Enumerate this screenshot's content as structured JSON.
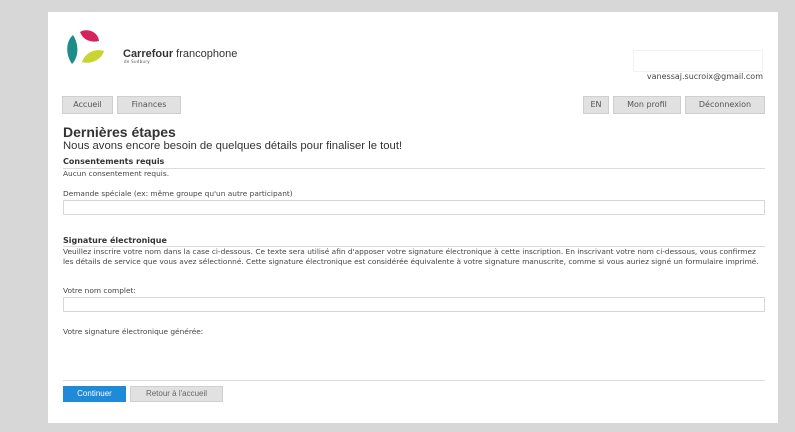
{
  "brand": {
    "name_bold": "Carrefour",
    "name_rest": " francophone",
    "subtitle": "de Sudbury",
    "colors": {
      "pink": "#d4245d",
      "teal": "#1c8e87",
      "lime": "#c8d530"
    }
  },
  "user": {
    "email": "vanessaj.sucroix@gmail.com"
  },
  "nav": {
    "left": [
      "Accueil",
      "Finances"
    ],
    "right": [
      "EN",
      "Mon profil",
      "Déconnexion"
    ]
  },
  "page": {
    "title": "Dernières étapes",
    "subtitle": "Nous avons encore besoin de quelques détails pour finaliser le tout!"
  },
  "consent": {
    "heading": "Consentements requis",
    "text": "Aucun consentement requis."
  },
  "special": {
    "label": "Demande spéciale (ex: même groupe qu'un autre participant)",
    "value": ""
  },
  "signature": {
    "heading": "Signature électronique",
    "description": "Veuillez inscrire votre nom dans la case ci-dessous. Ce texte sera utilisé afin d'apposer votre signature électronique à cette inscription. En inscrivant votre nom ci-dessous, vous confirmez les détails de service que vous avez sélectionné. Cette signature électronique est considérée équivalente à votre signature manuscrite, comme si vous auriez signé un formulaire imprimé.",
    "name_label": "Votre nom complet:",
    "name_value": "",
    "generated_label": "Votre signature électronique générée:"
  },
  "actions": {
    "continue": "Continuer",
    "back": "Retour à l'accueil"
  },
  "colors": {
    "page_bg": "#d7d7d7",
    "primary": "#1e8ad8",
    "nav_bg": "#e1e1e1"
  }
}
